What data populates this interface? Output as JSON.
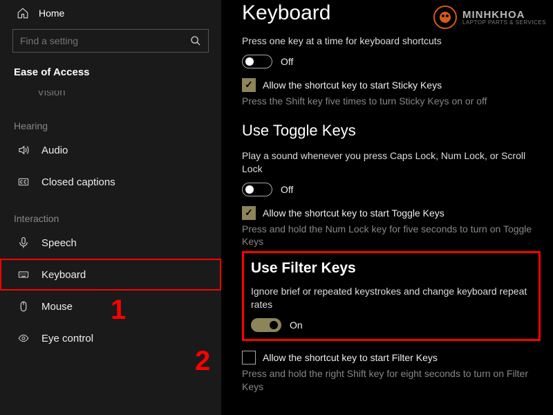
{
  "sidebar": {
    "home": "Home",
    "search_placeholder": "Find a setting",
    "category": "Ease of Access",
    "truncated_item": "Vision",
    "groups": [
      {
        "label": "Hearing",
        "items": [
          {
            "id": "audio",
            "label": "Audio",
            "icon": "speaker-icon"
          },
          {
            "id": "closed-captions",
            "label": "Closed captions",
            "icon": "captions-icon"
          }
        ]
      },
      {
        "label": "Interaction",
        "items": [
          {
            "id": "speech",
            "label": "Speech",
            "icon": "mic-icon"
          },
          {
            "id": "keyboard",
            "label": "Keyboard",
            "icon": "keyboard-icon",
            "selected": true
          },
          {
            "id": "mouse",
            "label": "Mouse",
            "icon": "mouse-icon"
          },
          {
            "id": "eye-control",
            "label": "Eye control",
            "icon": "eye-icon"
          }
        ]
      }
    ]
  },
  "page": {
    "title": "Keyboard",
    "sticky": {
      "desc": "Press one key at a time for keyboard shortcuts",
      "toggle_state": "off",
      "toggle_label": "Off",
      "shortcut_checked": true,
      "shortcut_label": "Allow the shortcut key to start Sticky Keys",
      "shortcut_hint": "Press the Shift key five times to turn Sticky Keys on or off"
    },
    "toggle_keys": {
      "heading": "Use Toggle Keys",
      "desc": "Play a sound whenever you press Caps Lock, Num Lock, or Scroll Lock",
      "toggle_state": "off",
      "toggle_label": "Off",
      "shortcut_checked": true,
      "shortcut_label": "Allow the shortcut key to start Toggle Keys",
      "shortcut_hint": "Press and hold the Num Lock key for five seconds to turn on Toggle Keys"
    },
    "filter_keys": {
      "heading": "Use Filter Keys",
      "desc": "Ignore brief or repeated keystrokes and change keyboard repeat rates",
      "toggle_state": "on",
      "toggle_label": "On",
      "shortcut_checked": false,
      "shortcut_label": "Allow the shortcut key to start Filter Keys",
      "shortcut_hint": "Press and hold the right Shift key for eight seconds to turn on Filter Keys"
    }
  },
  "annotations": {
    "one": "1",
    "two": "2"
  },
  "watermark": {
    "name": "MINHKHOA",
    "tag": "LAPTOP PARTS & SERVICES"
  },
  "colors": {
    "accent_olive": "#8d8459",
    "annotation_red": "#ff0000",
    "brand_orange": "#f0641e"
  }
}
